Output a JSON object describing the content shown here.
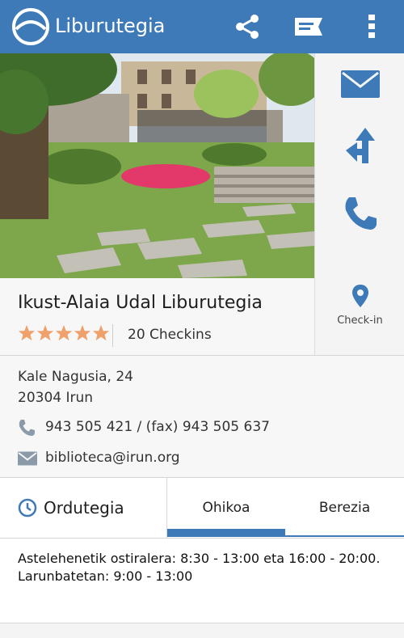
{
  "appbar": {
    "title": "Liburutegia",
    "icons": [
      "logo-icon",
      "share-icon",
      "message-icon",
      "more-vert-icon"
    ]
  },
  "sidebar": {
    "icons": [
      "mail-icon",
      "directions-icon",
      "phone-icon",
      "location-pin-icon"
    ],
    "checkin_label": "Check-in"
  },
  "place": {
    "name": "Ikust-Alaia Udal Liburutegia",
    "rating": 5,
    "rating_max": 5,
    "checkins": "20 Checkins"
  },
  "contact": {
    "street": "Kale Nagusia, 24",
    "city": "20304 Irun",
    "phone": "943 505 421 / (fax) 943 505 637",
    "email": "biblioteca@irun.org"
  },
  "schedule": {
    "title": "Ordutegia",
    "tabs": [
      "Ohikoa",
      "Berezia"
    ],
    "active_tab": "Ohikoa",
    "lines": [
      "Astelehenetik ostiralera: 8:30 - 13:00 eta 16:00 - 20:00.",
      "Larunbatetan: 9:00 - 13:00"
    ]
  },
  "colors": {
    "accent": "#3e7ab8",
    "star": "#f0a06a",
    "panel": "#f7f7f7"
  }
}
